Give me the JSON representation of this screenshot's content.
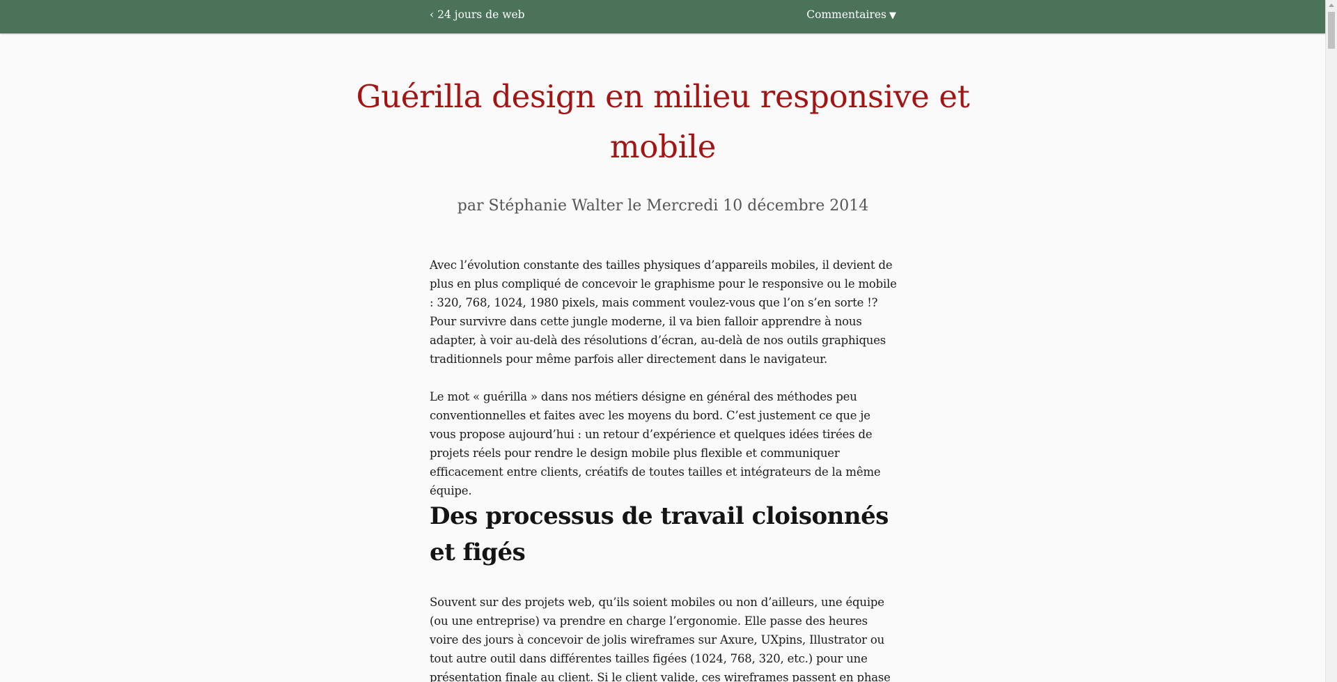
{
  "nav": {
    "back_label": "‹ 24 jours de web",
    "comments_label": "Commentaires",
    "comments_arrow": "▼"
  },
  "article": {
    "title": "Guérilla design en milieu responsive et mobile",
    "byline": "par Stéphanie Walter le Mercredi 10 décembre 2014",
    "paragraphs": [
      "Avec l’évolution constante des tailles physiques d’appareils mobiles, il devient de plus en plus compliqué de concevoir le graphisme pour le responsive ou le mobile : 320, 768, 1024, 1980 pixels, mais comment voulez-vous que l’on s’en sorte !? Pour survivre dans cette jungle moderne, il va bien falloir apprendre à nous adapter, à voir au-delà des résolutions d’écran, au-delà de nos outils graphiques traditionnels pour même parfois aller directement dans le navigateur.",
      "Le mot « guérilla » dans nos métiers désigne en général des méthodes peu conventionnelles et faites avec les moyens du bord. C’est justement ce que je vous propose aujourd’hui : un retour d’expérience et quelques idées tirées de projets réels pour rendre le design mobile plus flexible et communiquer efficacement entre clients, créatifs de toutes tailles et intégrateurs de la même équipe."
    ],
    "section_heading": "Des processus de travail cloisonnés et figés",
    "section_paragraph": "Souvent sur des projets web, qu’ils soient mobiles ou non d’ailleurs, une équipe (ou une entreprise) va prendre en charge l’ergonomie. Elle passe des heures voire des jours à concevoir de jolis wireframes sur Axure, UXpins, Illustrator ou tout autre outil dans différentes tailles figées (1024, 768, 320, etc.) pour une présentation finale au client. Si le client valide, ces wireframes passent en phase de design. Sinon, on refait"
  },
  "colors": {
    "topbar": "#4a735a",
    "title": "#a31414",
    "byline": "#555555",
    "body_text": "#1a1a1a"
  }
}
